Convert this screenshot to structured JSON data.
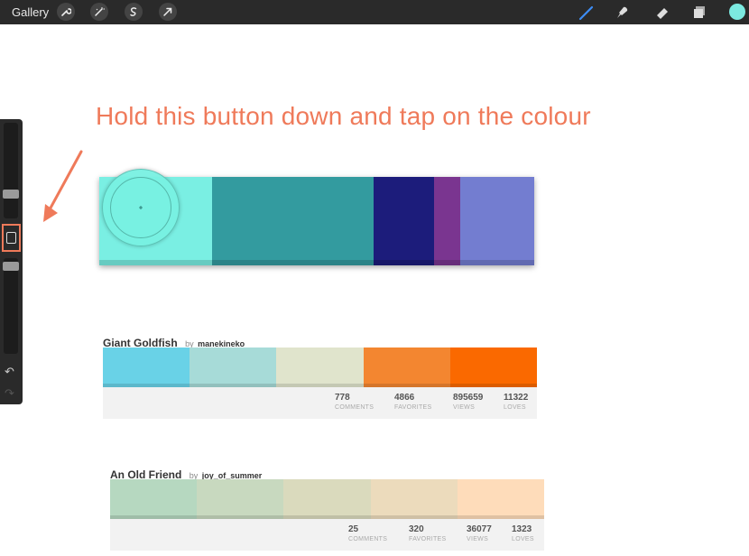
{
  "toolbar": {
    "gallery_label": "Gallery",
    "left_tools": [
      "wrench-icon",
      "magic-wand-icon",
      "selection-icon",
      "transform-arrow-icon"
    ],
    "right_tools": [
      "brush-icon",
      "smudge-icon",
      "eraser-icon",
      "layers-icon"
    ],
    "current_color": "#7ce9e0"
  },
  "annotation": {
    "text": "Hold this button down and tap on the colour",
    "color": "#ef7a5a"
  },
  "big_palette": {
    "colors": [
      {
        "hex": "#7aefe3",
        "fraction": 0.26
      },
      {
        "hex": "#339b9f",
        "fraction": 0.37
      },
      {
        "hex": "#1c1c7b",
        "fraction": 0.14
      },
      {
        "hex": "#7a3590",
        "fraction": 0.06
      },
      {
        "hex": "#737dd0",
        "fraction": 0.17
      }
    ]
  },
  "palettes": [
    {
      "title": "Giant Goldfish",
      "by": "by",
      "author": "manekineko",
      "colors": [
        "#69d2e7",
        "#a7dbd8",
        "#e0e4cc",
        "#f38630",
        "#fa6900"
      ],
      "stats": [
        {
          "value": "778",
          "label": "COMMENTS"
        },
        {
          "value": "4866",
          "label": "FAVORITES"
        },
        {
          "value": "895659",
          "label": "VIEWS"
        },
        {
          "value": "11322",
          "label": "LOVES"
        }
      ]
    },
    {
      "title": "An Old Friend",
      "by": "by",
      "author": "joy_of_summer",
      "colors": [
        "#b6d8c0",
        "#c8d9bf",
        "#dadabd",
        "#ecdbbc",
        "#fedcba"
      ],
      "stats": [
        {
          "value": "25",
          "label": "COMMENTS"
        },
        {
          "value": "320",
          "label": "FAVORITES"
        },
        {
          "value": "36077",
          "label": "VIEWS"
        },
        {
          "value": "1323",
          "label": "LOVES"
        }
      ]
    }
  ]
}
